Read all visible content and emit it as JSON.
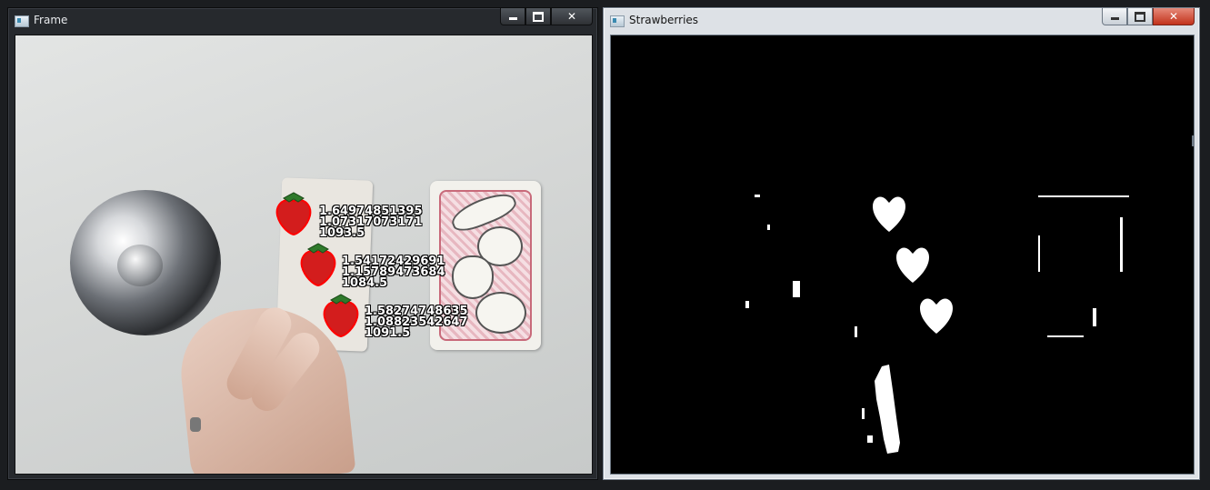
{
  "windows": {
    "left": {
      "title": "Frame"
    },
    "right": {
      "title": "Strawberries"
    }
  },
  "controls": {
    "minimize_icon": "minimize-icon",
    "maximize_icon": "maximize-icon",
    "close_icon": "close-icon"
  },
  "detections": [
    {
      "line1": "1.64974851395",
      "line2": "1.07317073171",
      "line3": "1093.5"
    },
    {
      "line1": "1.54172429691",
      "line2": "1.15789473684",
      "line3": "1084.5"
    },
    {
      "line1": "1.58274748635",
      "line2": "1.08823542647",
      "line3": "1091.5"
    }
  ],
  "colors": {
    "outline_red": "#ff0000",
    "strawberry": "#d31d1d",
    "mask_fg": "#ffffff",
    "mask_bg": "#000000"
  }
}
